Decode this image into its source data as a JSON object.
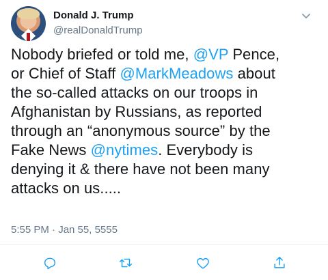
{
  "author": {
    "name": "Donald J. Trump",
    "handle": "@realDonaldTrump"
  },
  "tweet": {
    "lines": [
      {
        "segments": [
          {
            "text": "Nobody briefed or told me, ",
            "type": "text"
          },
          {
            "text": "@VP",
            "type": "mention"
          },
          {
            "text": " Pence,",
            "type": "text"
          }
        ]
      },
      {
        "segments": [
          {
            "text": "or Chief of Staff ",
            "type": "text"
          },
          {
            "text": "@MarkMeadows",
            "type": "mention"
          },
          {
            "text": " about",
            "type": "text"
          }
        ]
      },
      {
        "segments": [
          {
            "text": "the so-called attacks on our troops in",
            "type": "text"
          }
        ]
      },
      {
        "segments": [
          {
            "text": "Afghanistan by Russians, as reported",
            "type": "text"
          }
        ]
      },
      {
        "segments": [
          {
            "text": "through an “anonymous source” by the",
            "type": "text"
          }
        ]
      },
      {
        "segments": [
          {
            "text": "Fake News ",
            "type": "text"
          },
          {
            "text": "@nytimes",
            "type": "mention"
          },
          {
            "text": ". Everybody is",
            "type": "text"
          }
        ]
      },
      {
        "segments": [
          {
            "text": "denying it & there have not been many",
            "type": "text"
          }
        ]
      },
      {
        "segments": [
          {
            "text": "attacks on us.....",
            "type": "text"
          }
        ]
      }
    ]
  },
  "timestamp": "5:55 PM · Jan 55, 5555",
  "colors": {
    "accent": "#1da1f2",
    "secondary_text": "#657786",
    "icon": "#1da1f2",
    "divider": "#e6ecf0"
  },
  "icons": {
    "menu": "chevron-down-icon",
    "reply": "reply-icon",
    "retweet": "retweet-icon",
    "like": "heart-icon",
    "share": "share-icon"
  }
}
